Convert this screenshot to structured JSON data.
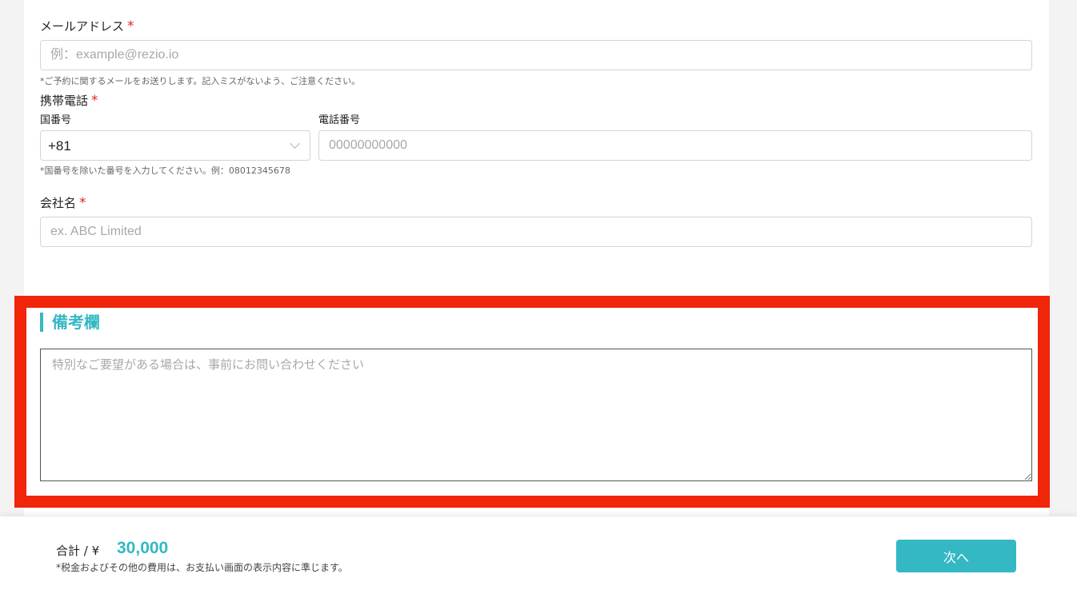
{
  "email": {
    "label": "メールアドレス",
    "required_mark": "*",
    "placeholder": "例：example@rezio.io",
    "hint": "*ご予約に関するメールをお送りします。記入ミスがないよう、ご注意ください。"
  },
  "phone": {
    "label": "携帯電話",
    "required_mark": "*",
    "country_code_label": "国番号",
    "country_code_value": "+81",
    "number_label": "電話番号",
    "number_placeholder": "00000000000",
    "hint": "*国番号を除いた番号を入力してください。例：08012345678"
  },
  "company": {
    "label": "会社名",
    "required_mark": "*",
    "placeholder": "ex. ABC Limited"
  },
  "notes": {
    "title": "備考欄",
    "placeholder": "特別なご要望がある場合は、事前にお問い合わせください"
  },
  "footer": {
    "total_label": "合計 / ¥",
    "total_value": "30,000",
    "tax_note": "*税金およびその他の費用は、お支払い画面の表示内容に準じます。",
    "next_label": "次へ"
  },
  "colors": {
    "accent": "#34b8c4",
    "required": "#e0251b",
    "highlight_border": "#f0250a"
  },
  "icons": {
    "select_arrow": "chevron-down-icon"
  }
}
